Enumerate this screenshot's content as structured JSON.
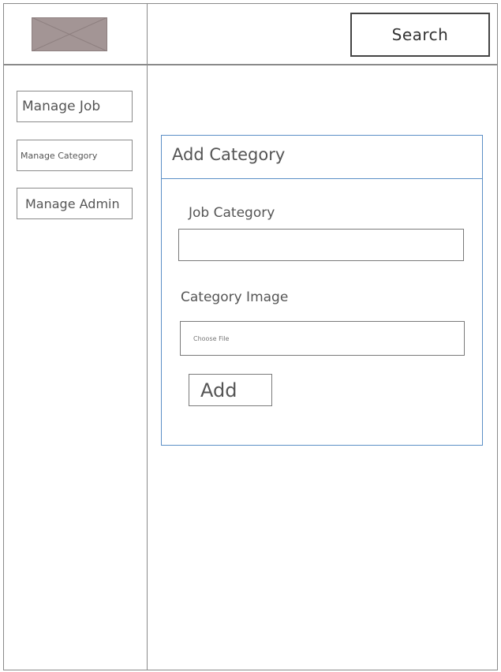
{
  "header": {
    "search_label": "Search"
  },
  "sidebar": {
    "items": [
      {
        "label": "Manage Job"
      },
      {
        "label": "Manage Category"
      },
      {
        "label": "Manage Admin"
      }
    ]
  },
  "panel": {
    "title": "Add Category",
    "job_category_label": "Job Category",
    "job_category_value": "",
    "category_image_label": "Category Image",
    "file_placeholder": "Choose File",
    "add_label": "Add"
  },
  "colors": {
    "panel_border": "#5b8fc6",
    "logo_fill": "#a39595",
    "frame_border": "#8a8a8a"
  }
}
